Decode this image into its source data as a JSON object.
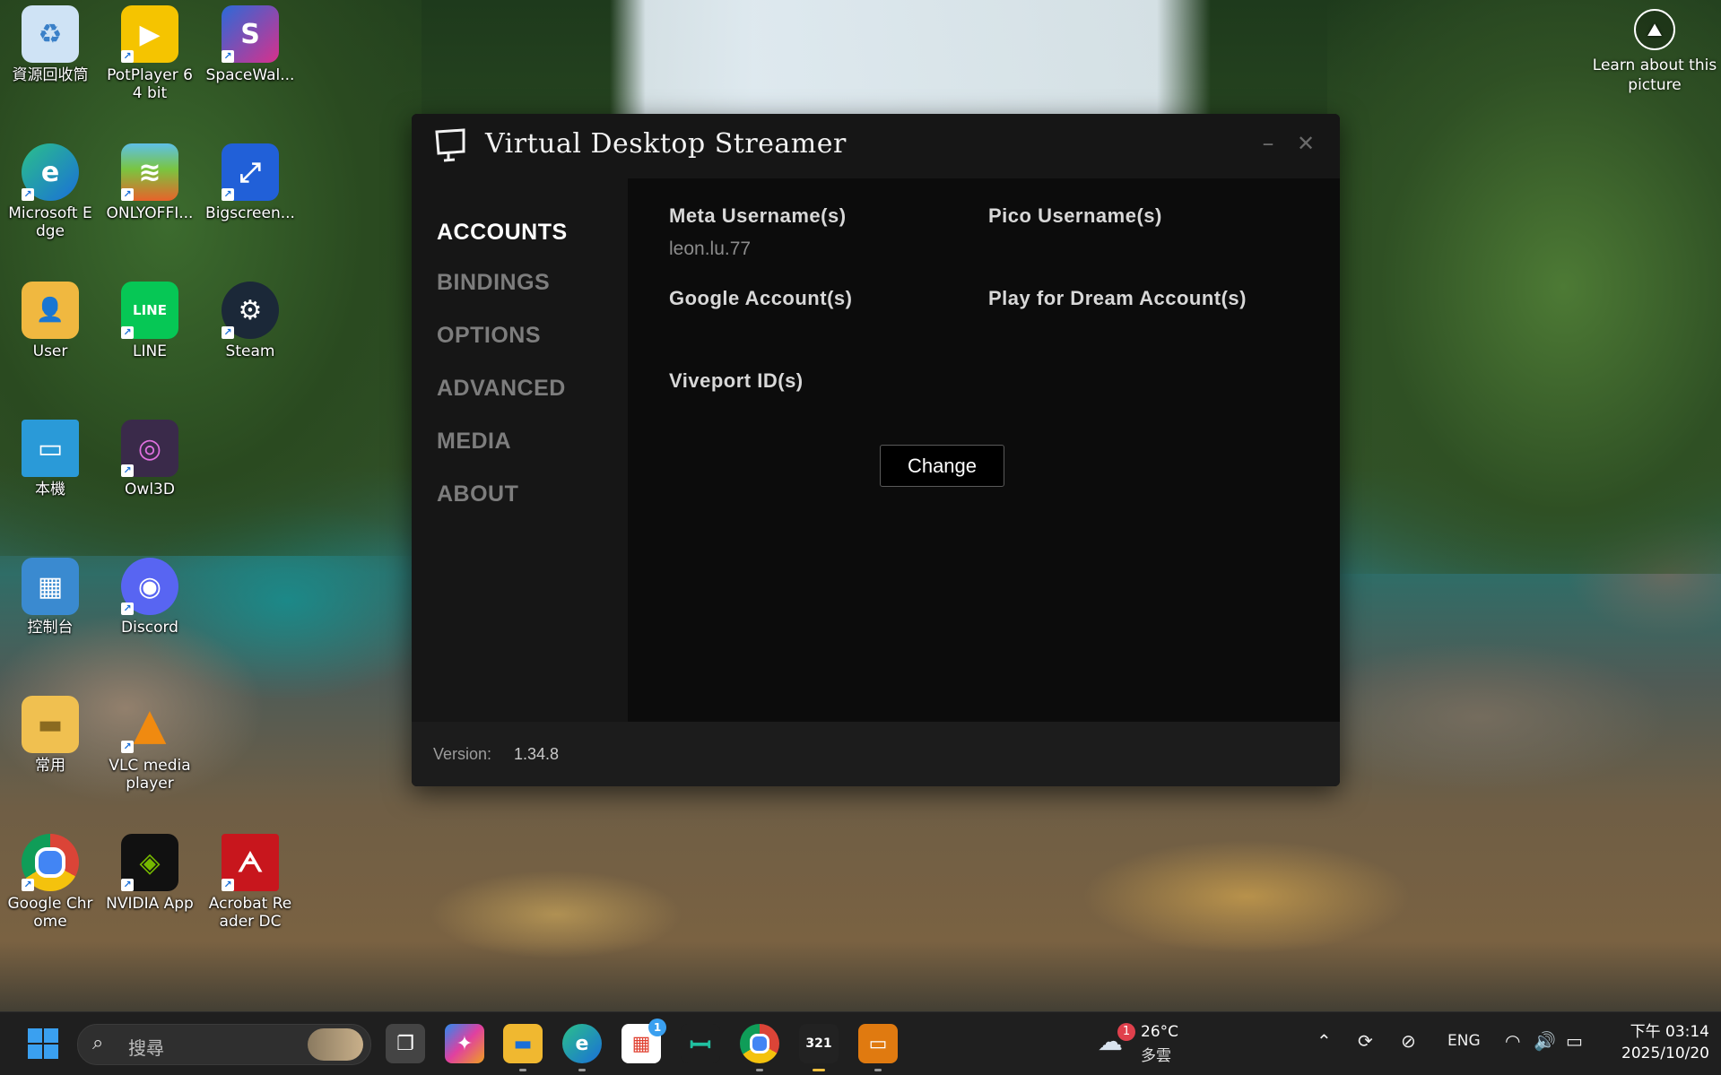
{
  "desktop": {
    "icons": [
      {
        "label": "資源回收筒",
        "glyph": "♻",
        "color": "#5aa0d8"
      },
      {
        "label": "PotPlayer 64 bit",
        "glyph": "▶",
        "color": "#f5c400"
      },
      {
        "label": "SpaceWal...",
        "glyph": "S",
        "color": "#c23a8c"
      },
      {
        "label": "Microsoft Edge",
        "glyph": "e",
        "color": "#1e88c8"
      },
      {
        "label": "ONLYOFFI...",
        "glyph": "≋",
        "color": "#e8622a"
      },
      {
        "label": "Bigscreen...",
        "glyph": "⤢",
        "color": "#2160d8"
      },
      {
        "label": "User",
        "glyph": "👤",
        "color": "#f0b840"
      },
      {
        "label": "LINE",
        "glyph": "LINE",
        "color": "#06c755"
      },
      {
        "label": "Steam",
        "glyph": "⚙",
        "color": "#1b2838"
      },
      {
        "label": "本機",
        "glyph": "▭",
        "color": "#2a9ad8"
      },
      {
        "label": "Owl3D",
        "glyph": "◎",
        "color": "#3a2a4a"
      },
      {
        "label": "控制台",
        "glyph": "▦",
        "color": "#3a8ad0"
      },
      {
        "label": "Discord",
        "glyph": "◉",
        "color": "#5865f2"
      },
      {
        "label": "常用",
        "glyph": "▬",
        "color": "#f0c050"
      },
      {
        "label": "VLC media player",
        "glyph": "▲",
        "color": "#e87a10"
      },
      {
        "label": "Google Chrome",
        "glyph": "◍",
        "color": "#d84030"
      },
      {
        "label": "NVIDIA App",
        "glyph": "◈",
        "color": "#111"
      },
      {
        "label": "Acrobat Reader DC",
        "glyph": "ᗅ",
        "color": "#c8161d"
      }
    ],
    "learn_about": "Learn about this picture"
  },
  "app": {
    "title": "Virtual Desktop Streamer",
    "nav": [
      "ACCOUNTS",
      "BINDINGS",
      "OPTIONS",
      "ADVANCED",
      "MEDIA",
      "ABOUT"
    ],
    "active_nav": "ACCOUNTS",
    "fields": {
      "meta_label": "Meta Username(s)",
      "meta_value": "leon.lu.77",
      "pico_label": "Pico Username(s)",
      "google_label": "Google Account(s)",
      "play_for_dream_label": "Play for Dream Account(s)",
      "viveport_label": "Viveport ID(s)"
    },
    "change_label": "Change",
    "version_label": "Version:",
    "version_value": "1.34.8"
  },
  "taskbar": {
    "search_placeholder": "搜尋",
    "weather": {
      "badge": "1",
      "temp": "26°C",
      "condition": "多雲"
    },
    "store_badge": "1",
    "language": "ENG",
    "time": "下午 03:14",
    "date": "2025/10/20"
  }
}
